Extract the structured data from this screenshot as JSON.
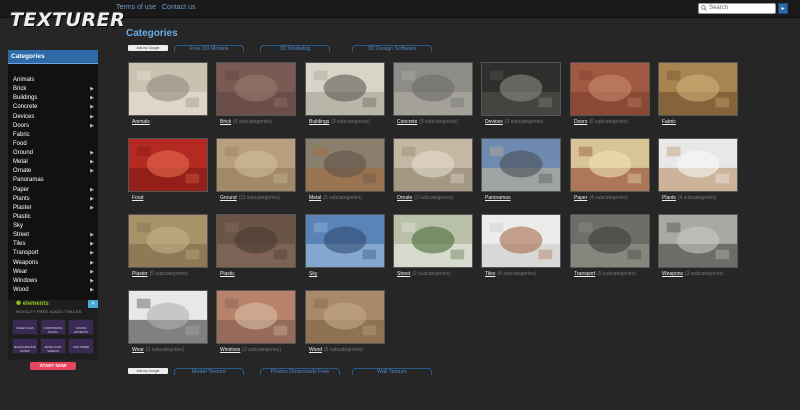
{
  "logo": "TEXTURER",
  "topbar": {
    "links": [
      "Terms of use",
      "Contact us"
    ],
    "search_placeholder": "Search"
  },
  "sidebar": {
    "title": "Categories",
    "items": [
      {
        "label": "Animals",
        "arrow": false
      },
      {
        "label": "Brick",
        "arrow": true
      },
      {
        "label": "Buildings",
        "arrow": true
      },
      {
        "label": "Concrete",
        "arrow": true
      },
      {
        "label": "Devices",
        "arrow": true
      },
      {
        "label": "Doors",
        "arrow": true
      },
      {
        "label": "Fabric",
        "arrow": false
      },
      {
        "label": "Food",
        "arrow": false
      },
      {
        "label": "Ground",
        "arrow": true
      },
      {
        "label": "Metal",
        "arrow": true
      },
      {
        "label": "Ornate",
        "arrow": true
      },
      {
        "label": "Panoramas",
        "arrow": false
      },
      {
        "label": "Paper",
        "arrow": true
      },
      {
        "label": "Plants",
        "arrow": true
      },
      {
        "label": "Plaster",
        "arrow": true
      },
      {
        "label": "Plastic",
        "arrow": false
      },
      {
        "label": "Sky",
        "arrow": false
      },
      {
        "label": "Street",
        "arrow": true
      },
      {
        "label": "Tiles",
        "arrow": true
      },
      {
        "label": "Transport",
        "arrow": true
      },
      {
        "label": "Weapons",
        "arrow": true
      },
      {
        "label": "Wear",
        "arrow": true
      },
      {
        "label": "Windows",
        "arrow": true
      },
      {
        "label": "Wood",
        "arrow": true
      }
    ]
  },
  "ad": {
    "brand": "elements",
    "subtitle": "ROYALTY FREE AUDIO TRACKS",
    "tiles": [
      "FREE FILES",
      "CORPORATE MUSIC",
      "SOUND EFFECTS",
      "BACKGROUND MUSIC",
      "MUSIC FOR VIDEOS",
      "AND MORE"
    ],
    "cta": "START NOW"
  },
  "main": {
    "heading": "Categories",
    "ad_choices": "Ads by Google",
    "top_pills": [
      "Free 3D Models",
      "3D Modeling",
      "3D Design Software"
    ],
    "bottom_pills": [
      "Model Texture",
      "Photos Downloads Free",
      "Wall Texture"
    ],
    "cards": [
      {
        "name": "Animals",
        "sub": "",
        "colors": [
          "#c9c2b0",
          "#efe8dc",
          "#8f8a7f"
        ]
      },
      {
        "name": "Brick",
        "sub": "(5 subcategories)",
        "colors": [
          "#7a5a52",
          "#5e4640",
          "#9a7a70"
        ]
      },
      {
        "name": "Buildings",
        "sub": "(5 subcategories)",
        "colors": [
          "#d9d4c8",
          "#9e9a90",
          "#5e5a54"
        ]
      },
      {
        "name": "Concrete",
        "sub": "(5 subcategories)",
        "colors": [
          "#8e8c86",
          "#b4b2ac",
          "#6c6a66"
        ]
      },
      {
        "name": "Devices",
        "sub": "(3 subcategories)",
        "colors": [
          "#2e2e2c",
          "#5a5854",
          "#8c8a84"
        ]
      },
      {
        "name": "Doors",
        "sub": "(6 subcategories)",
        "colors": [
          "#a05a44",
          "#7a3a2a",
          "#c88a6e"
        ]
      },
      {
        "name": "Fabric",
        "sub": "",
        "colors": [
          "#a88452",
          "#6a4a26",
          "#d2b07a"
        ]
      },
      {
        "name": "Food",
        "sub": "",
        "colors": [
          "#b42a22",
          "#7a1610",
          "#e86a4e"
        ]
      },
      {
        "name": "Ground",
        "sub": "(11 subcategories)",
        "colors": [
          "#b8a07e",
          "#8e7656",
          "#d2bc98"
        ]
      },
      {
        "name": "Metal",
        "sub": "(5 subcategories)",
        "colors": [
          "#8a7e6c",
          "#a86a3a",
          "#5e5448"
        ]
      },
      {
        "name": "Ornate",
        "sub": "(3 subcategories)",
        "colors": [
          "#c4b8a4",
          "#8a7e6c",
          "#e6dccc"
        ]
      },
      {
        "name": "Panoramas",
        "sub": "",
        "colors": [
          "#6e8ab0",
          "#c8b896",
          "#4a4e56"
        ]
      },
      {
        "name": "Paper",
        "sub": "(4 subcategories)",
        "colors": [
          "#d8c494",
          "#8a3a2a",
          "#f2e2b8"
        ]
      },
      {
        "name": "Plants",
        "sub": "(4 subcategories)",
        "colors": [
          "#e8e8e8",
          "#b4865a",
          "#f8f8f8"
        ]
      },
      {
        "name": "Plaster",
        "sub": "(5 subcategories)",
        "colors": [
          "#a8926a",
          "#7a6648",
          "#c4b088"
        ]
      },
      {
        "name": "Plastic",
        "sub": "",
        "colors": [
          "#6a5448",
          "#8a7060",
          "#4a3a30"
        ]
      },
      {
        "name": "Sky",
        "sub": "",
        "colors": [
          "#5a84b8",
          "#a8c4e4",
          "#2e4a72"
        ]
      },
      {
        "name": "Street",
        "sub": "(2 subcategories)",
        "colors": [
          "#b8c0a8",
          "#f0f0ec",
          "#4a6a3a"
        ]
      },
      {
        "name": "Tiles",
        "sub": "(4 subcategories)",
        "colors": [
          "#ececea",
          "#c8c8c4",
          "#a86a4a"
        ]
      },
      {
        "name": "Transport",
        "sub": "(5 subcategories)",
        "colors": [
          "#6e6e68",
          "#9a9a92",
          "#3e3e3a"
        ]
      },
      {
        "name": "Weapons",
        "sub": "(3 subcategories)",
        "colors": [
          "#a8a8a4",
          "#3a3a38",
          "#c8c8c4"
        ]
      },
      {
        "name": "Wear",
        "sub": "(3 subcategories)",
        "colors": [
          "#e8e8e8",
          "#2a2a2a",
          "#b0b0b0"
        ]
      },
      {
        "name": "Windows",
        "sub": "(3 subcategories)",
        "colors": [
          "#b8826a",
          "#7a5a4a",
          "#d8c0a8"
        ]
      },
      {
        "name": "Wood",
        "sub": "(5 subcategories)",
        "colors": [
          "#a88a6a",
          "#7a5e42",
          "#c4a888"
        ]
      }
    ]
  }
}
